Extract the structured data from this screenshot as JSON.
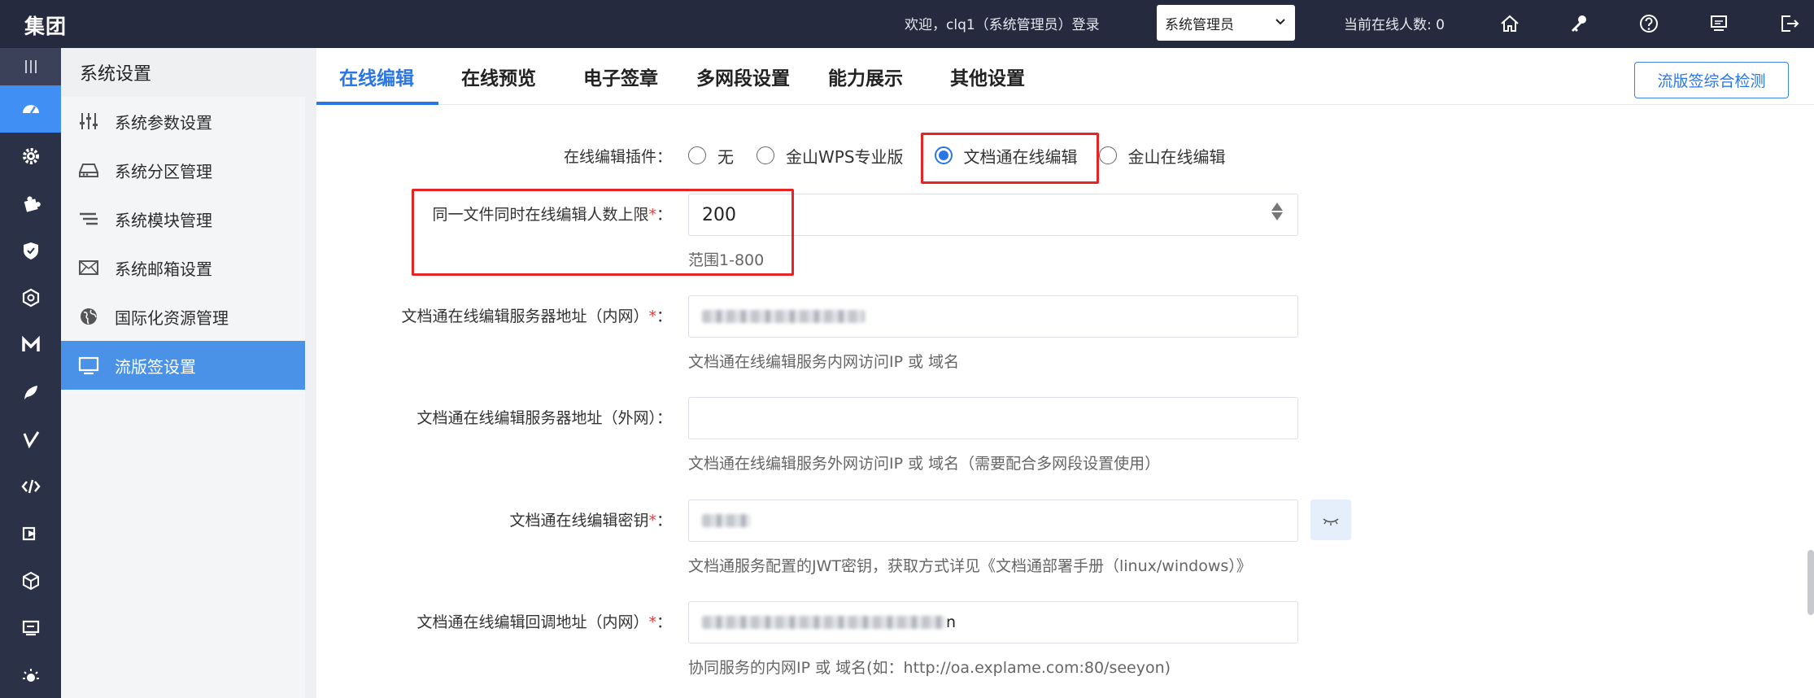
{
  "topbar": {
    "brand": "集团",
    "welcome": "欢迎，clq1（系统管理员）登录",
    "role_selected": "系统管理员",
    "online_count": "当前在线人数: 0",
    "icons": [
      "home-icon",
      "key-icon",
      "help-icon",
      "monitor-icon",
      "logout-icon"
    ]
  },
  "rail": {
    "icons": [
      "menu-collapse-icon",
      "dashboard-icon",
      "gear-icon",
      "puzzle-icon",
      "shield-icon",
      "hexagon-icon",
      "m-icon",
      "feather-icon",
      "pen-icon",
      "code-icon",
      "play-icon",
      "cube-icon",
      "monitor-icon",
      "sun-icon"
    ]
  },
  "sidebar": {
    "title": "系统设置",
    "items": [
      {
        "label": "系统参数设置",
        "icon": "sliders-icon"
      },
      {
        "label": "系统分区管理",
        "icon": "drive-icon"
      },
      {
        "label": "系统模块管理",
        "icon": "list-icon"
      },
      {
        "label": "系统邮箱设置",
        "icon": "mail-icon"
      },
      {
        "label": "国际化资源管理",
        "icon": "globe-icon"
      },
      {
        "label": "流版签设置",
        "icon": "monitor-icon",
        "active": true
      }
    ]
  },
  "tabs": {
    "items": [
      "在线编辑",
      "在线预览",
      "电子签章",
      "多网段设置",
      "能力展示",
      "其他设置"
    ],
    "active": 0,
    "check_button": "流版签综合检测"
  },
  "form": {
    "plugin": {
      "label": "在线编辑插件",
      "options": [
        "无",
        "金山WPS专业版",
        "文档通在线编辑",
        "金山在线编辑"
      ],
      "selected": 2
    },
    "max_editors": {
      "label": "同一文件同时在线编辑人数上限",
      "value": "200",
      "hint": "范围1-800"
    },
    "server_internal": {
      "label": "文档通在线编辑服务器地址（内网）",
      "hint": "文档通在线编辑服务内网访问IP 或 域名"
    },
    "server_external": {
      "label": "文档通在线编辑服务器地址（外网）",
      "hint": "文档通在线编辑服务外网访问IP 或 域名（需要配合多网段设置使用）"
    },
    "secret": {
      "label": "文档通在线编辑密钥",
      "hint": "文档通服务配置的JWT密钥，获取方式详见《文档通部署手册（linux/windows）》"
    },
    "callback": {
      "label": "文档通在线编辑回调地址（内网）",
      "value_tail": "n",
      "hint": "协同服务的内网IP 或 域名(如：http://oa.explame.com:80/seeyon)"
    }
  },
  "colors": {
    "topbar_bg": "#252a3e",
    "accent": "#2a76e6",
    "highlight_red": "#e62424"
  }
}
